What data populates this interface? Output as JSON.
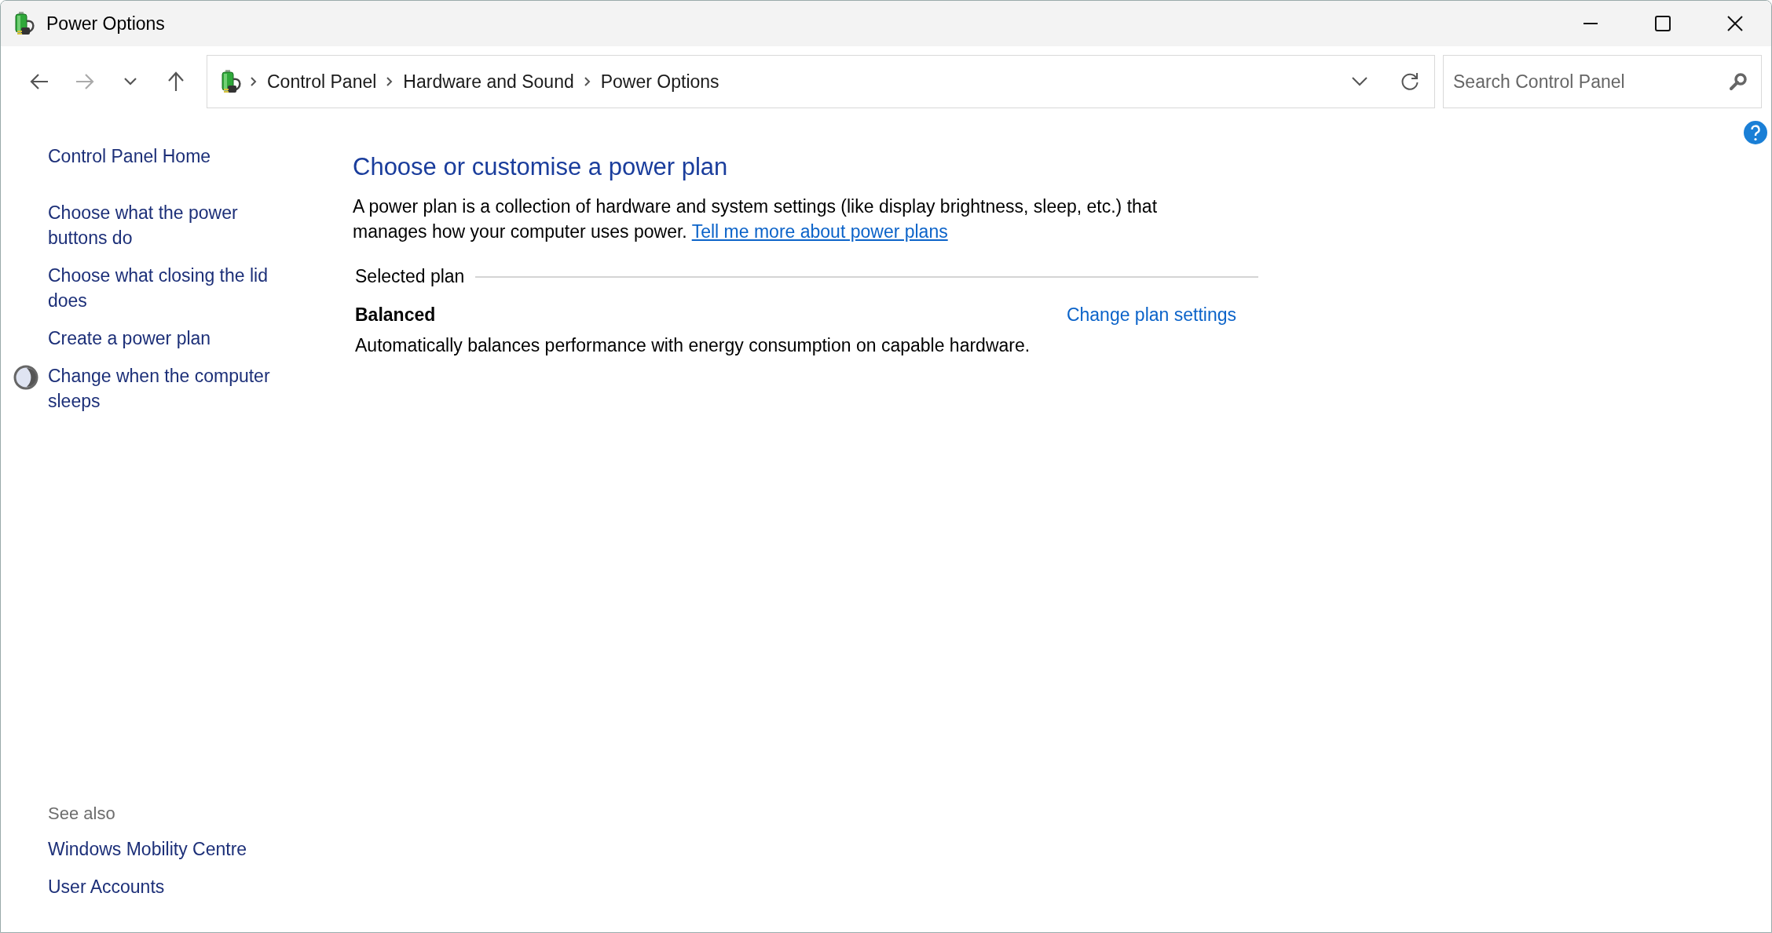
{
  "window": {
    "title": "Power Options"
  },
  "navigation": {
    "forward_disabled": true,
    "breadcrumbs": [
      "Control Panel",
      "Hardware and Sound",
      "Power Options"
    ],
    "search": {
      "placeholder": "Search Control Panel"
    }
  },
  "sidebar": {
    "items": [
      {
        "label": "Control Panel Home",
        "kind": "home"
      },
      {
        "label": "Choose what the power buttons do",
        "kind": "link"
      },
      {
        "label": "Choose what closing the lid does",
        "kind": "link"
      },
      {
        "label": "Create a power plan",
        "kind": "link"
      },
      {
        "label": "Change when the computer sleeps",
        "kind": "icon-link"
      }
    ],
    "see_also": {
      "heading": "See also",
      "links": [
        "Windows Mobility Centre",
        "User Accounts"
      ]
    }
  },
  "main": {
    "heading": "Choose or customise a power plan",
    "description": "A power plan is a collection of hardware and system settings (like display brightness, sleep, etc.) that manages how your computer uses power.",
    "more_link": "Tell me more about power plans",
    "section_label": "Selected plan",
    "plans": [
      {
        "name": "Balanced",
        "action": "Change plan settings",
        "description": "Automatically balances performance with energy consumption on capable hardware."
      }
    ]
  }
}
